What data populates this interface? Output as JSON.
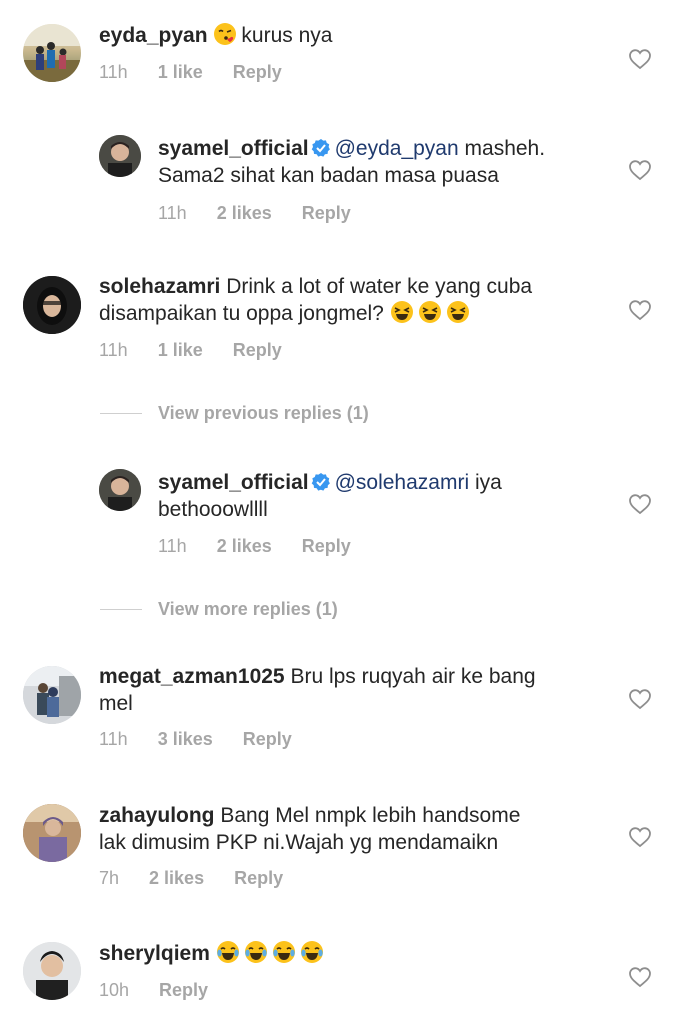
{
  "comments": [
    {
      "user": "eyda_pyan",
      "text": "kurus nya",
      "time": "11h",
      "likes": "1 like",
      "reply": "Reply"
    },
    {
      "user": "syamel_official",
      "mention": "@eyda_pyan",
      "text": "masheh.",
      "text2": "Sama2 sihat kan badan masa puasa",
      "time": "11h",
      "likes": "2 likes",
      "reply": "Reply"
    },
    {
      "user": "solehazamri",
      "text": "Drink a lot of water ke yang cuba",
      "text2": "disampaikan tu oppa jongmel?",
      "time": "11h",
      "likes": "1 like",
      "reply": "Reply"
    },
    {
      "view_label": "View previous replies (1)"
    },
    {
      "user": "syamel_official",
      "mention": "@solehazamri",
      "text": "iya",
      "text2": "bethooowllll",
      "time": "11h",
      "likes": "2 likes",
      "reply": "Reply"
    },
    {
      "view_label": "View more replies (1)"
    },
    {
      "user": "megat_azman1025",
      "text": "Bru lps ruqyah air ke bang",
      "text2": "mel",
      "time": "11h",
      "likes": "3 likes",
      "reply": "Reply"
    },
    {
      "user": "zahayulong",
      "text": "Bang Mel nmpk lebih handsome",
      "text2": "lak dimusim PKP ni.Wajah yg mendamaikn",
      "time": "7h",
      "likes": "2 likes",
      "reply": "Reply"
    },
    {
      "user": "sherylqiem",
      "text": "",
      "time": "10h",
      "reply": "Reply"
    }
  ],
  "icons": {
    "heart": "heart-outline-icon",
    "verified": "verified-badge-icon",
    "emoji_kiss": "face-blowing-kiss-emoji",
    "emoji_laugh": "grinning-squinting-emoji",
    "emoji_joy": "tears-of-joy-emoji"
  },
  "colors": {
    "text": "#262626",
    "meta": "#a6a6a6",
    "mention": "#1f3a6e",
    "verified": "#3897f0"
  }
}
